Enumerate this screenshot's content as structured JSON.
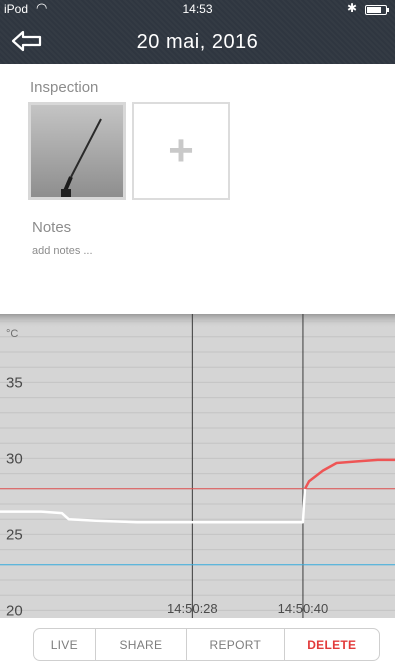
{
  "status_bar": {
    "carrier": "iPod",
    "time": "14:53"
  },
  "nav": {
    "title": "20 mai, 2016",
    "back_icon": "back-arrow-icon"
  },
  "inspection": {
    "label": "Inspection",
    "photo_icon": "photo-thumbnail",
    "add_symbol": "+"
  },
  "notes": {
    "label": "Notes",
    "placeholder": "add notes ..."
  },
  "chart_data": {
    "type": "line",
    "unit_label": "°C",
    "ylim": [
      19.5,
      39.5
    ],
    "y_ticks": [
      20,
      25,
      30,
      35
    ],
    "x_ticks": [
      "14:50:28",
      "14:50:40"
    ],
    "x": [
      0,
      6,
      9,
      10,
      14,
      20,
      24,
      28,
      30,
      35,
      40,
      43,
      44.1,
      44.4,
      45,
      47,
      49,
      52,
      55,
      57.5
    ],
    "series": [
      {
        "values": [
          26.5,
          26.5,
          26.4,
          26.0,
          25.9,
          25.8,
          25.8,
          25.8,
          25.8,
          25.8,
          25.8,
          25.8,
          25.8,
          28.0,
          28.5,
          29.2,
          29.7,
          29.8,
          29.9,
          29.9
        ]
      }
    ],
    "reference_lines": [
      {
        "value": 28,
        "color": "#e05050"
      },
      {
        "value": 23,
        "color": "#3aaee0"
      }
    ],
    "grid": true,
    "colors": {
      "normal": "#ffffff",
      "above": "#ee5555",
      "background": "#d5d5d5"
    }
  },
  "toolbar": {
    "live": "LIVE",
    "share": "SHARE",
    "report": "REPORT",
    "delete": "DELETE"
  }
}
